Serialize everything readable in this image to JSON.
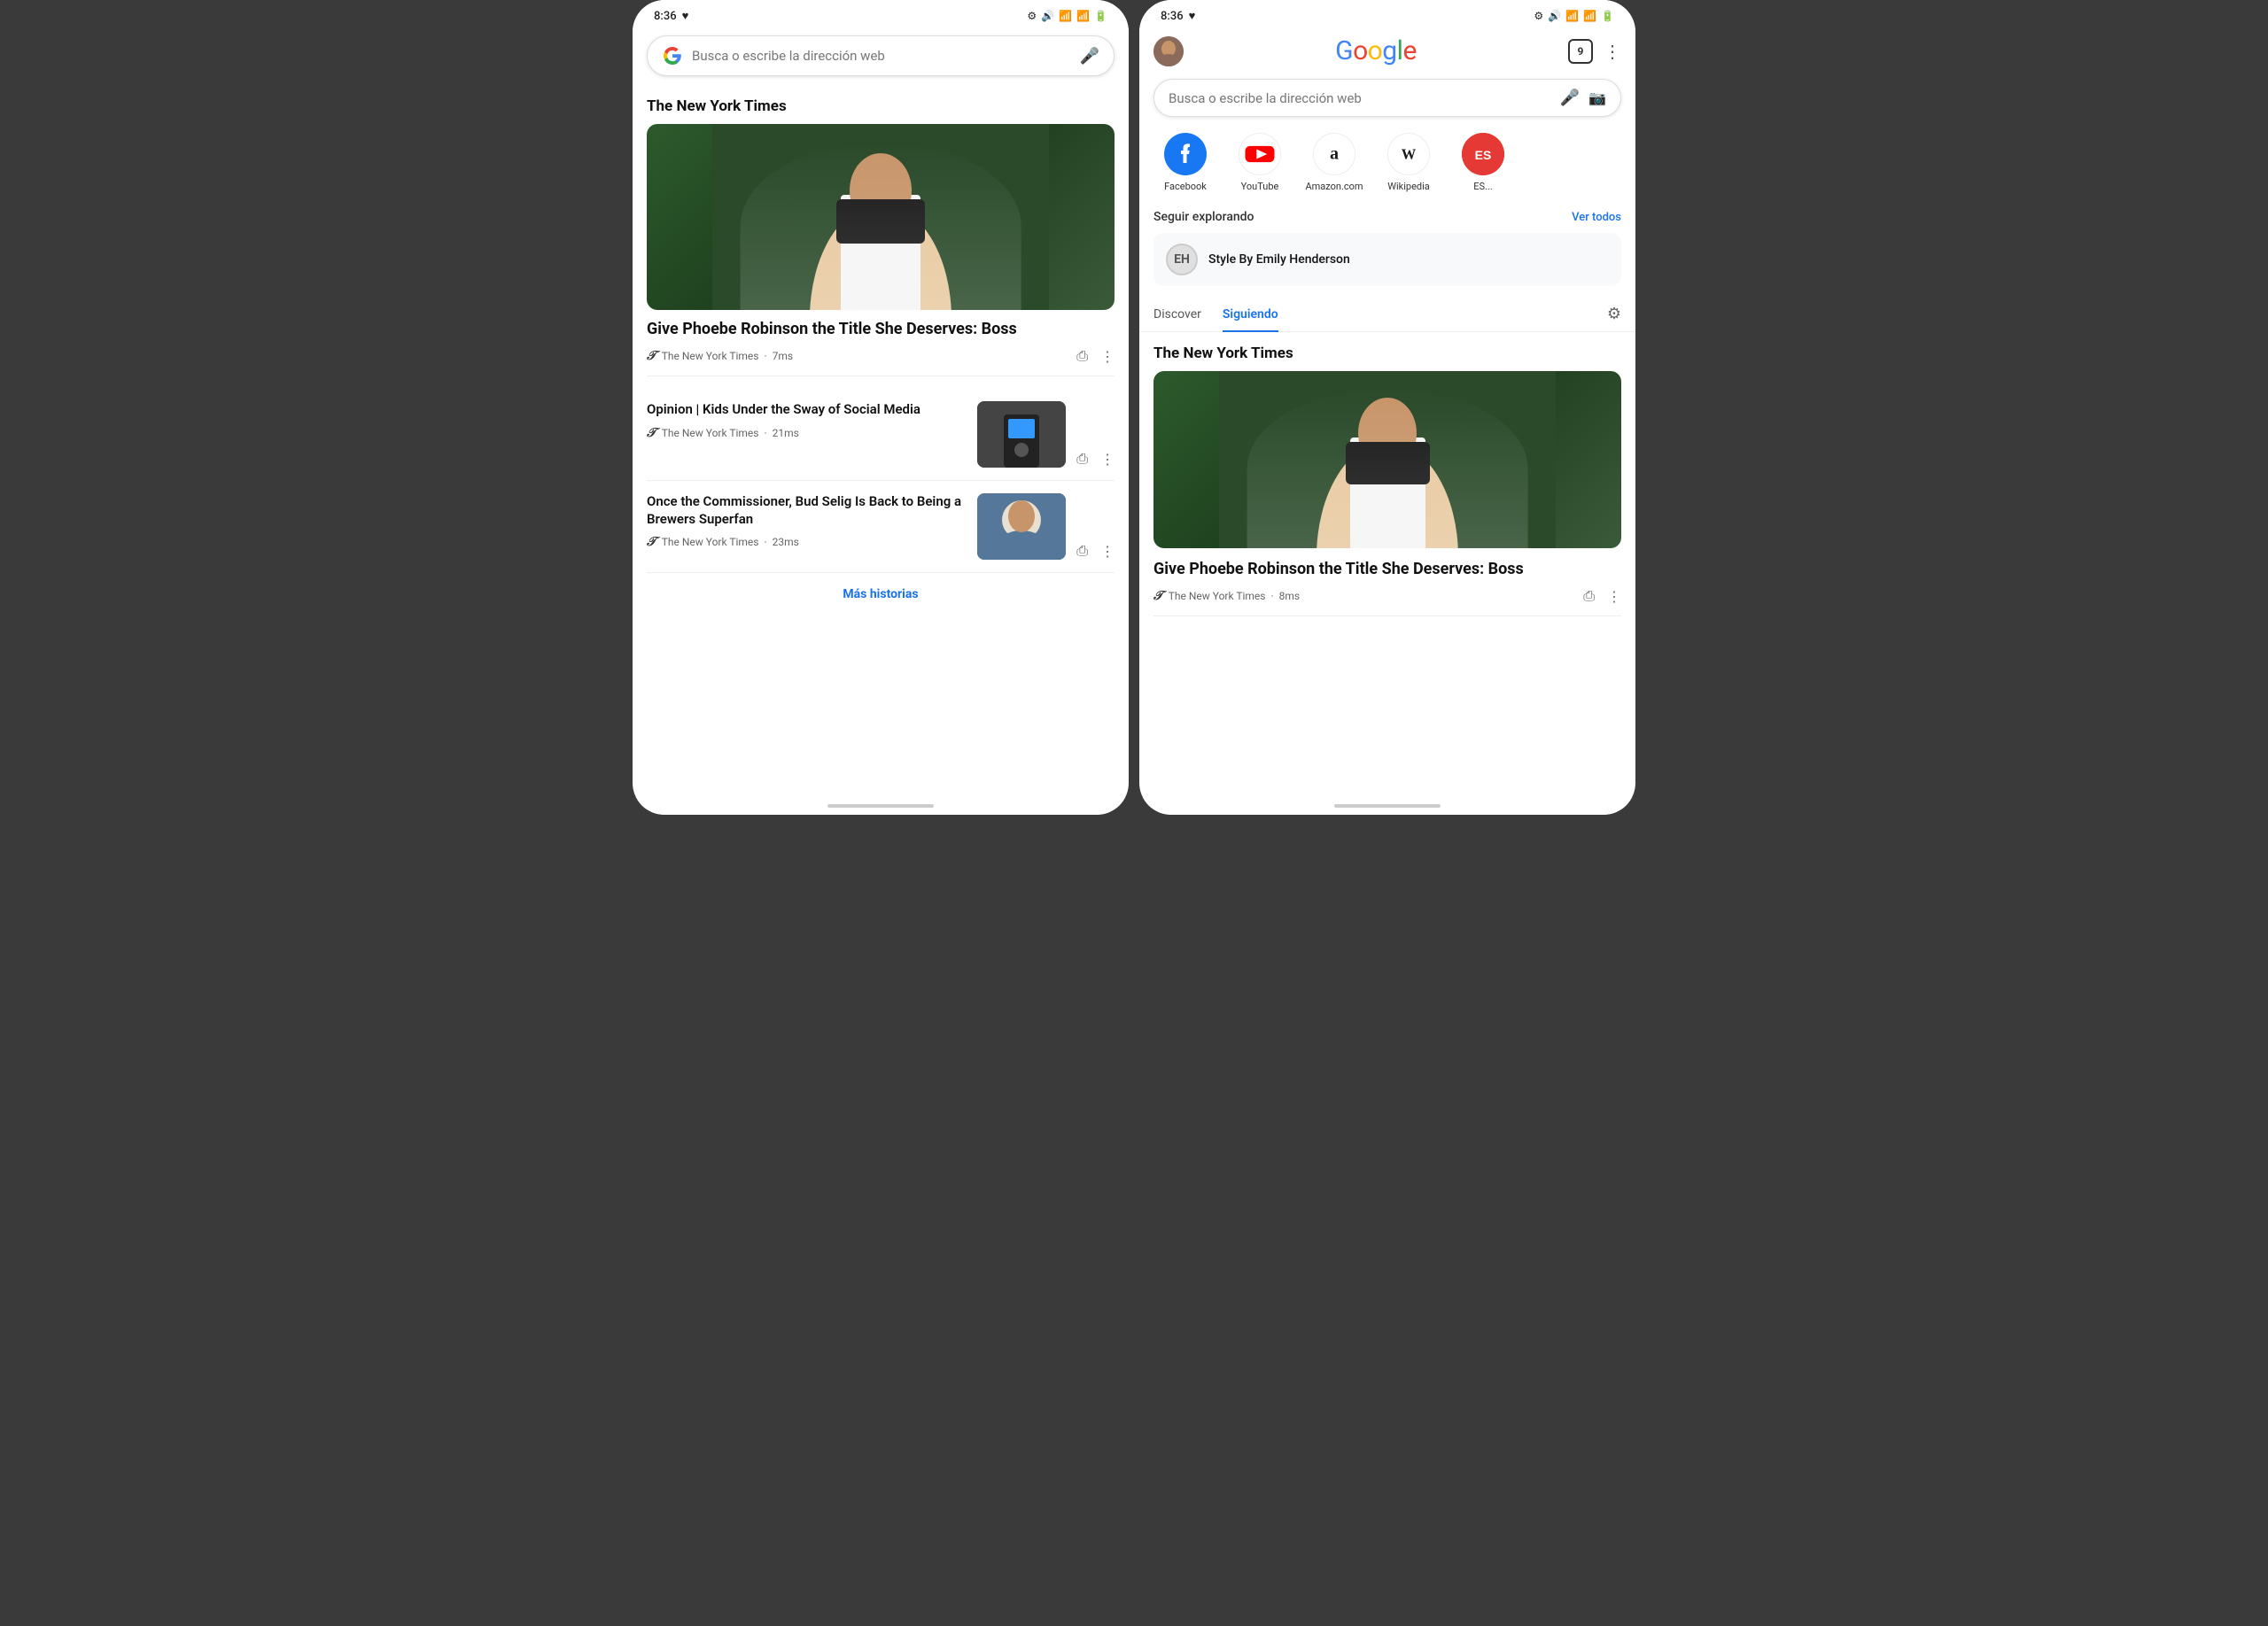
{
  "phone1": {
    "status": {
      "time": "8:36",
      "heart_icon": "♥",
      "icons": "⚙ 🔊 📶 📶 🔋"
    },
    "search": {
      "placeholder": "Busca o escribe la dirección web"
    },
    "section_title": "The New York Times",
    "articles": [
      {
        "title": "Give Phoebe Robinson the Title She Deserves: Boss",
        "source": "The New York Times",
        "time": "7ms",
        "has_image": true,
        "image_type": "woman"
      },
      {
        "title": "Opinion | Kids Under the Sway of Social Media",
        "source": "The New York Times",
        "time": "21ms",
        "has_thumbnail": true,
        "image_type": "social"
      },
      {
        "title": "Once the Commissioner, Bud Selig Is Back to Being a Brewers Superfan",
        "source": "The New York Times",
        "time": "23ms",
        "has_thumbnail": true,
        "image_type": "baseball"
      }
    ],
    "more_stories": "Más historias"
  },
  "phone2": {
    "status": {
      "time": "8:36",
      "heart_icon": "♥",
      "icons": "⚙ 🔊 📶 📶 🔋"
    },
    "google_logo": "Google",
    "tabs_count": "9",
    "search": {
      "placeholder": "Busca o escribe la dirección web"
    },
    "shortcuts": [
      {
        "name": "Facebook",
        "type": "facebook"
      },
      {
        "name": "YouTube",
        "type": "youtube"
      },
      {
        "name": "Amazon.com",
        "type": "amazon"
      },
      {
        "name": "Wikipedia",
        "type": "wikipedia"
      },
      {
        "name": "ES...",
        "type": "partial"
      }
    ],
    "seguir": {
      "title": "Seguir explorando",
      "ver_todos": "Ver todos",
      "items": [
        {
          "name": "Style By Emily Henderson",
          "icon": "EH"
        }
      ]
    },
    "tabs": [
      {
        "label": "Discover",
        "active": false
      },
      {
        "label": "Siguiendo",
        "active": true
      }
    ],
    "section_title": "The New York Times",
    "articles": [
      {
        "title": "Give Phoebe Robinson the Title She Deserves: Boss",
        "source": "The New York Times",
        "time": "8ms",
        "has_image": true,
        "image_type": "woman"
      }
    ]
  },
  "colors": {
    "accent_blue": "#1a73e8",
    "google_blue": "#4285F4",
    "google_red": "#EA4335",
    "google_yellow": "#FBBC05",
    "google_green": "#34A853",
    "facebook_blue": "#1877F2",
    "youtube_red": "#FF0000",
    "bg": "#3a3a3a"
  }
}
